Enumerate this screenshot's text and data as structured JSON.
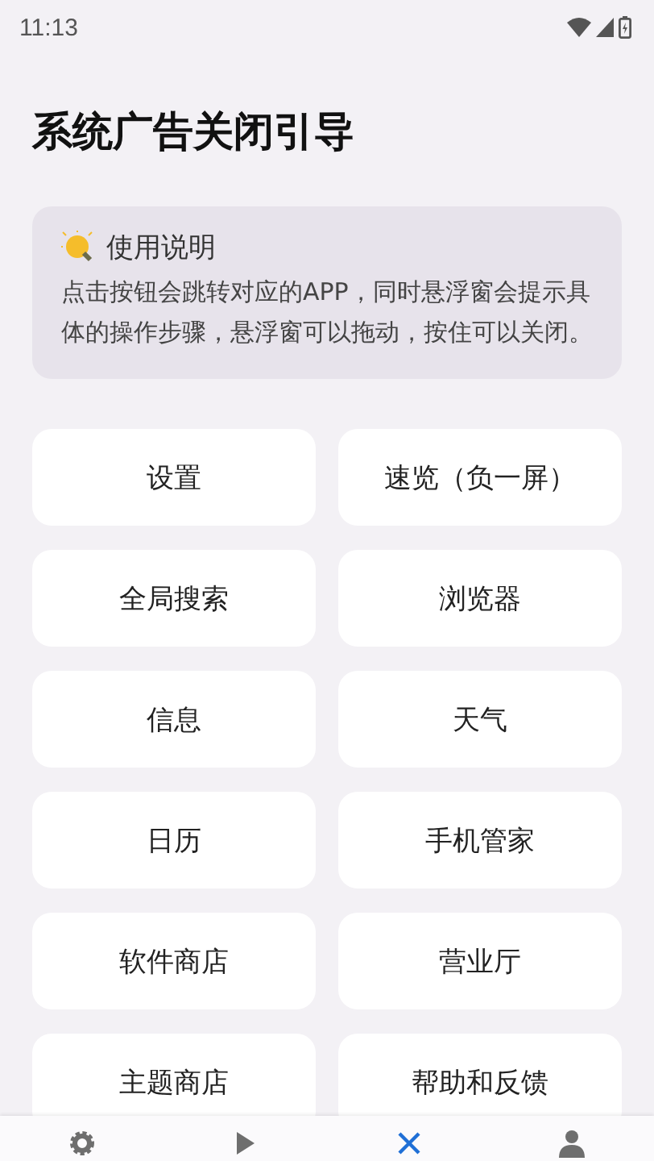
{
  "status_bar": {
    "time": "11:13"
  },
  "title": "系统广告关闭引导",
  "info_card": {
    "heading": "使用说明",
    "text": "点击按钮会跳转对应的APP，同时悬浮窗会提示具体的操作步骤，悬浮窗可以拖动，按住可以关闭。"
  },
  "buttons": [
    "设置",
    "速览（负一屏）",
    "全局搜索",
    "浏览器",
    "信息",
    "天气",
    "日历",
    "手机管家",
    "软件商店",
    "营业厅",
    "主题商店",
    "帮助和反馈"
  ],
  "bottom_nav": [
    {
      "kind": "settings",
      "selected": false
    },
    {
      "kind": "play",
      "selected": false
    },
    {
      "kind": "close",
      "selected": true
    },
    {
      "kind": "person",
      "selected": false
    }
  ]
}
